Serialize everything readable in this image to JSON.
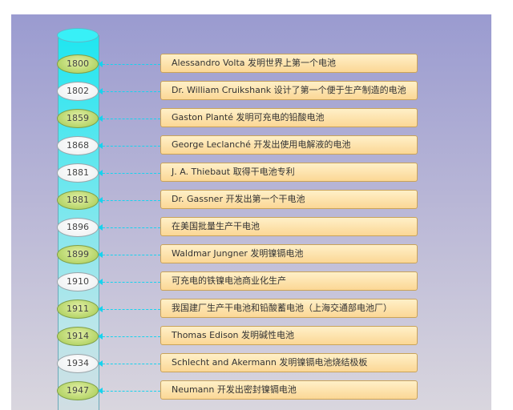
{
  "timeline": [
    {
      "year": "1800",
      "event": "Alessandro Volta 发明世界上第一个电池",
      "marker": "green"
    },
    {
      "year": "1802",
      "event": "Dr. William Cruikshank 设计了第一个便于生产制造的电池",
      "marker": "white"
    },
    {
      "year": "1859",
      "event": "Gaston Planté 发明可充电的铅酸电池",
      "marker": "green"
    },
    {
      "year": "1868",
      "event": "George Leclanché 开发出使用电解液的电池",
      "marker": "white"
    },
    {
      "year": "1881",
      "event": "J. A. Thiebaut 取得干电池专利",
      "marker": "white"
    },
    {
      "year": "1881",
      "event": "Dr. Gassner 开发出第一个干电池",
      "marker": "green"
    },
    {
      "year": "1896",
      "event": "在美国批量生产干电池",
      "marker": "white"
    },
    {
      "year": "1899",
      "event": "Waldmar Jungner 发明镍镉电池",
      "marker": "green"
    },
    {
      "year": "1910",
      "event": "可充电的铁镍电池商业化生产",
      "marker": "white"
    },
    {
      "year": "1911",
      "event": "我国建厂生产干电池和铅酸蓄电池（上海交通部电池厂）",
      "marker": "green"
    },
    {
      "year": "1914",
      "event": "Thomas Edison 发明碱性电池",
      "marker": "green"
    },
    {
      "year": "1934",
      "event": "Schlecht and Akermann 发明镍镉电池烧结极板",
      "marker": "white"
    },
    {
      "year": "1947",
      "event": "Neumann 开发出密封镍镉电池",
      "marker": "green"
    }
  ],
  "colors": {
    "connector": "#17d3ee",
    "marker_green": "#b6d56a",
    "marker_white": "#f1f3f4",
    "label_fill": "#fbd795"
  }
}
